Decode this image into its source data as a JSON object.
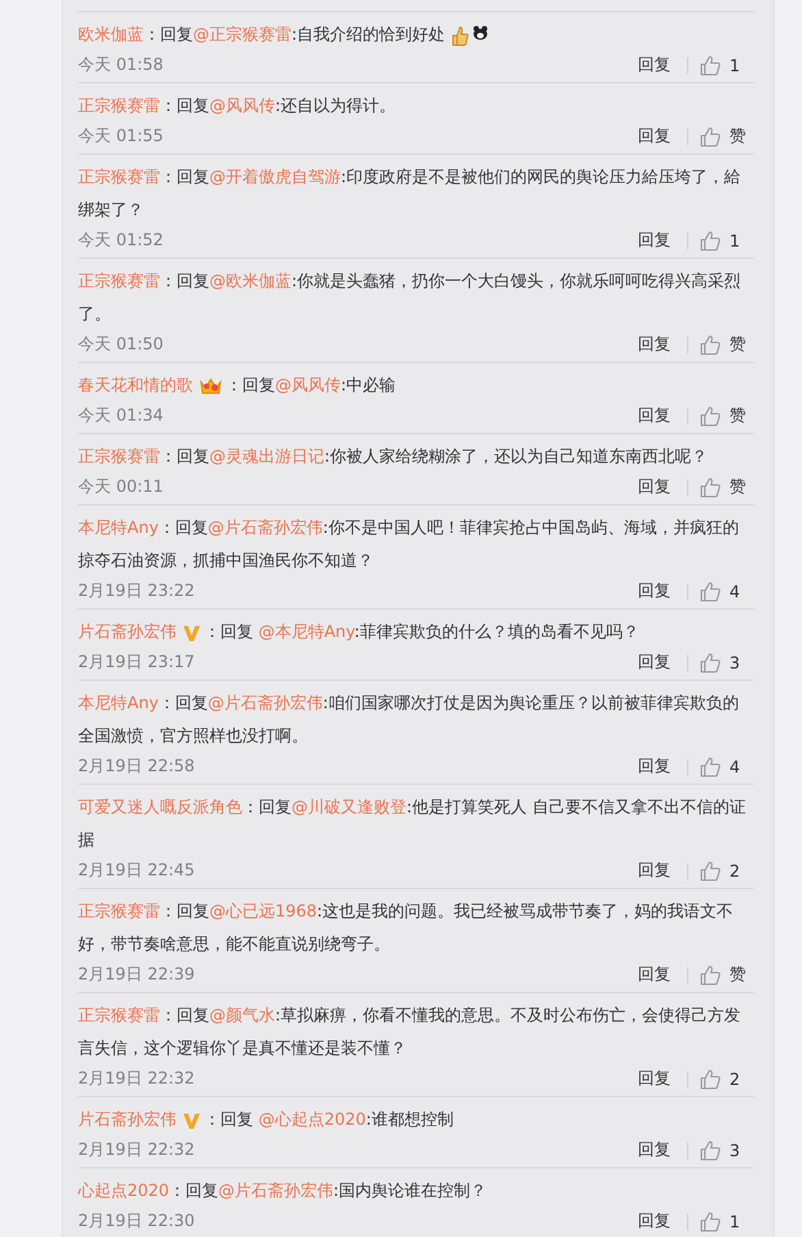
{
  "comments": [
    {
      "author": "欧米伽蓝",
      "reply_prefix": "：回复",
      "mention": "@正宗猴赛雷",
      "text": ":自我介绍的恰到好处",
      "has_emoji": true,
      "time": "今天 01:58",
      "reply_button": "回复",
      "like": "1"
    },
    {
      "author": "正宗猴赛雷",
      "reply_prefix": "：回复",
      "mention": "@风风传",
      "text": ":还自以为得计。",
      "time": "今天 01:55",
      "reply_button": "回复",
      "like": "赞"
    },
    {
      "author": "正宗猴赛雷",
      "reply_prefix": "：回复",
      "mention": "@开着傲虎自驾游",
      "text": ":印度政府是不是被他们的网民的舆论压力給压垮了，給绑架了？",
      "time": "今天 01:52",
      "reply_button": "回复",
      "like": "1"
    },
    {
      "author": "正宗猴赛雷",
      "reply_prefix": "：回复",
      "mention": "@欧米伽蓝",
      "text": ":你就是头蠢猪，扔你一个大白馒头，你就乐呵呵吃得兴高采烈了。",
      "time": "今天 01:50",
      "reply_button": "回复",
      "like": "赞"
    },
    {
      "author": "春天花和情的歌",
      "badge": {
        "kind": "crown"
      },
      "reply_prefix": "：回复",
      "mention": "@风风传",
      "text": ":中必输",
      "time": "今天 01:34",
      "reply_button": "回复",
      "like": "赞"
    },
    {
      "author": "正宗猴赛雷",
      "reply_prefix": "：回复",
      "mention": "@灵魂出游日记",
      "text": ":你被人家给绕糊涂了，还以为自己知道东南西北呢？",
      "time": "今天 00:11",
      "reply_button": "回复",
      "like": "赞"
    },
    {
      "author": "本尼特Any",
      "reply_prefix": "：回复",
      "mention": "@片石斋孙宏伟",
      "text": ":你不是中国人吧！菲律宾抢占中国岛屿、海域，并疯狂的掠夺石油资源，抓捕中国渔民你不知道？",
      "time": "2月19日 23:22",
      "reply_button": "回复",
      "like": "4"
    },
    {
      "author": "片石斋孙宏伟",
      "badge": {
        "kind": "verified"
      },
      "reply_prefix": "：回复 ",
      "mention": "@本尼特Any",
      "text": ":菲律宾欺负的什么？填的岛看不见吗？",
      "time": "2月19日 23:17",
      "reply_button": "回复",
      "like": "3"
    },
    {
      "author": "本尼特Any",
      "reply_prefix": "：回复",
      "mention": "@片石斋孙宏伟",
      "text": ":咱们国家哪次打仗是因为舆论重压？以前被菲律宾欺负的全国激愤，官方照样也没打啊。",
      "time": "2月19日 22:58",
      "reply_button": "回复",
      "like": "4"
    },
    {
      "author": "可爱又迷人嘅反派角色",
      "reply_prefix": "：回复",
      "mention": "@川破又逢败登",
      "text": ":他是打算笑死人 自己要不信又拿不出不信的证据",
      "time": "2月19日 22:45",
      "reply_button": "回复",
      "like": "2"
    },
    {
      "author": "正宗猴赛雷",
      "reply_prefix": "：回复",
      "mention": "@心已远1968",
      "text": ":这也是我的问题。我已经被骂成带节奏了，妈的我语文不好，带节奏啥意思，能不能直说别绕弯子。",
      "time": "2月19日 22:39",
      "reply_button": "回复",
      "like": "赞"
    },
    {
      "author": "正宗猴赛雷",
      "reply_prefix": "：回复",
      "mention": "@颜气水",
      "text": ":草拟麻痹，你看不懂我的意思。不及时公布伤亡，会使得己方发言失信，这个逻辑你丫是真不懂还是装不懂？",
      "time": "2月19日 22:32",
      "reply_button": "回复",
      "like": "2"
    },
    {
      "author": "片石斋孙宏伟",
      "badge": {
        "kind": "verified"
      },
      "reply_prefix": "：回复 ",
      "mention": "@心起点2020",
      "text": ":谁都想控制",
      "time": "2月19日 22:32",
      "reply_button": "回复",
      "like": "3"
    },
    {
      "author": "心起点2020",
      "reply_prefix": "：回复",
      "mention": "@片石斋孙宏伟",
      "text": ":国内舆论谁在控制？",
      "time": "2月19日 22:30",
      "reply_button": "回复",
      "like": "1"
    }
  ]
}
